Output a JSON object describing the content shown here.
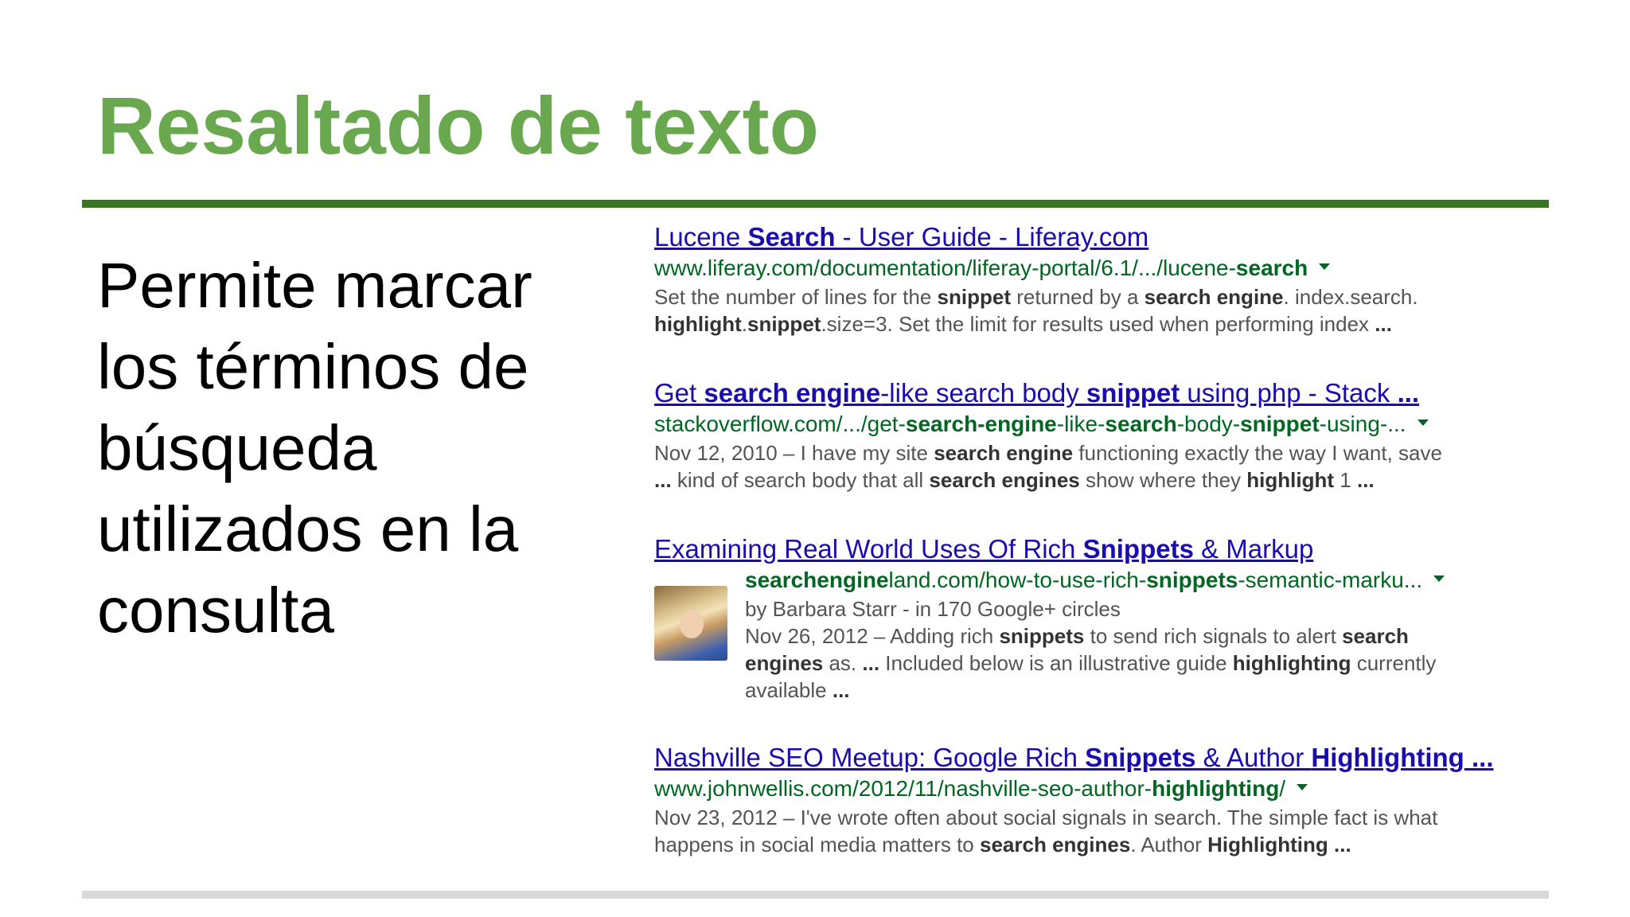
{
  "slide": {
    "title": "Resaltado de texto",
    "body": "Permite marcar los términos de búsqueda utilizados en la consulta"
  },
  "results": [
    {
      "title": [
        [
          "Lucene ",
          false
        ],
        [
          "Search",
          true
        ],
        [
          " - User Guide - Liferay.com",
          false
        ]
      ],
      "url": [
        [
          "www.liferay.com/documentation/liferay-portal/6.1/.../lucene-",
          false
        ],
        [
          "search",
          true
        ]
      ],
      "snippet": [
        [
          [
            "Set the number of lines for the ",
            false
          ],
          [
            "snippet",
            true
          ],
          [
            " returned by a ",
            false
          ],
          [
            "search engine",
            true
          ],
          [
            ". index.search.",
            false
          ]
        ],
        [
          [
            "highlight",
            true
          ],
          [
            ".",
            false
          ],
          [
            "snippet",
            true
          ],
          [
            ".size=3. Set the limit for results used when performing index ",
            false
          ],
          [
            "...",
            true
          ]
        ]
      ]
    },
    {
      "title": [
        [
          "Get ",
          false
        ],
        [
          "search engine",
          true
        ],
        [
          "-like search body ",
          false
        ],
        [
          "snippet",
          true
        ],
        [
          " using php - Stack ",
          false
        ],
        [
          "...",
          true
        ]
      ],
      "url": [
        [
          "stackoverflow.com/.../get-",
          false
        ],
        [
          "search-engine",
          true
        ],
        [
          "-like-",
          false
        ],
        [
          "search",
          true
        ],
        [
          "-body-",
          false
        ],
        [
          "snippet",
          true
        ],
        [
          "-using-...",
          false
        ]
      ],
      "snippet": [
        [
          [
            "Nov 12, 2010 – I have my site ",
            false
          ],
          [
            "search engine",
            true
          ],
          [
            " functioning exactly the way I want, save",
            false
          ]
        ],
        [
          [
            "...",
            true
          ],
          [
            " kind of search body that all ",
            false
          ],
          [
            "search engines",
            true
          ],
          [
            " show where they ",
            false
          ],
          [
            "highlight",
            true
          ],
          [
            " 1 ",
            false
          ],
          [
            "...",
            true
          ]
        ]
      ]
    },
    {
      "title": [
        [
          "Examining Real World Uses Of Rich ",
          false
        ],
        [
          "Snippets",
          true
        ],
        [
          " & Markup",
          false
        ]
      ],
      "url": [
        [
          "searchengine",
          true
        ],
        [
          "land.com/how-to-use-rich-",
          false
        ],
        [
          "snippets",
          true
        ],
        [
          "-semantic-marku...",
          false
        ]
      ],
      "snippet": [
        [
          [
            "by Barbara Starr - in 170 Google+ circles",
            false
          ]
        ],
        [
          [
            "Nov 26, 2012 – Adding rich ",
            false
          ],
          [
            "snippets",
            true
          ],
          [
            " to send rich signals to alert ",
            false
          ],
          [
            "search",
            true
          ]
        ],
        [
          [
            "engines",
            true
          ],
          [
            " as. ",
            false
          ],
          [
            "...",
            true
          ],
          [
            " Included below is an illustrative guide ",
            false
          ],
          [
            "highlighting",
            true
          ],
          [
            " currently",
            false
          ]
        ],
        [
          [
            "available ",
            false
          ],
          [
            "...",
            true
          ]
        ]
      ]
    },
    {
      "title": [
        [
          "Nashville SEO Meetup: Google Rich ",
          false
        ],
        [
          "Snippets",
          true
        ],
        [
          " & Author ",
          false
        ],
        [
          "Highlighting",
          true
        ],
        [
          " ",
          false
        ],
        [
          "...",
          true
        ]
      ],
      "url": [
        [
          "www.johnwellis.com/2012/11/nashville-seo-author-",
          false
        ],
        [
          "highlighting",
          true
        ],
        [
          "/",
          false
        ]
      ],
      "snippet": [
        [
          [
            "Nov 23, 2012 – I've wrote often about social signals in search. The simple fact is what",
            false
          ]
        ],
        [
          [
            "happens in social media matters to ",
            false
          ],
          [
            "search engines",
            true
          ],
          [
            ". Author ",
            false
          ],
          [
            "Highlighting",
            true
          ],
          [
            " ",
            false
          ],
          [
            "...",
            true
          ]
        ]
      ]
    }
  ]
}
